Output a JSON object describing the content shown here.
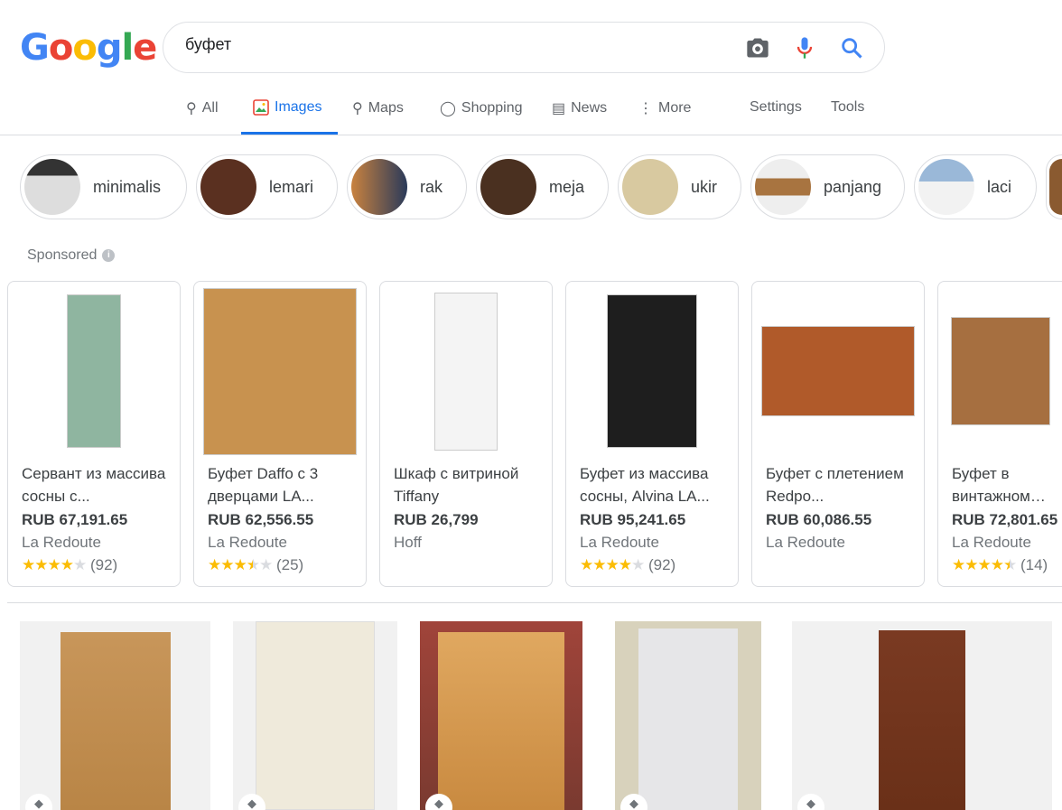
{
  "logo": "Google",
  "search": {
    "query": "буфет"
  },
  "tabs": [
    {
      "label": "All",
      "icon": "search-icon"
    },
    {
      "label": "Images",
      "icon": "image-icon"
    },
    {
      "label": "Maps",
      "icon": "map-pin-icon"
    },
    {
      "label": "Shopping",
      "icon": "tag-icon"
    },
    {
      "label": "News",
      "icon": "news-icon"
    },
    {
      "label": "More",
      "icon": "more-vert-icon"
    }
  ],
  "tools": {
    "settings": "Settings",
    "tools": "Tools"
  },
  "active_tab": "Images",
  "colors": {
    "accent": "#1a73e8",
    "star": "#fbbc04"
  },
  "chips": [
    {
      "label": "minimalis"
    },
    {
      "label": "lemari"
    },
    {
      "label": "rak"
    },
    {
      "label": "meja"
    },
    {
      "label": "ukir"
    },
    {
      "label": "panjang"
    },
    {
      "label": "laci"
    }
  ],
  "sponsored": {
    "label": "Sponsored"
  },
  "products": [
    {
      "title": "Сервант из массива сосны с...",
      "price": "RUB 67,191.65",
      "merchant": "La Redoute",
      "rating": 4,
      "reviews": "(92)"
    },
    {
      "title": "Буфет Daffo с 3 дверцами LA...",
      "price": "RUB 62,556.55",
      "merchant": "La Redoute",
      "rating": 3.5,
      "reviews": "(25)"
    },
    {
      "title": "Шкаф с витриной Tiffany",
      "price": "RUB 26,799",
      "merchant": "Hoff",
      "rating": null,
      "reviews": ""
    },
    {
      "title": "Буфет из массива сосны, Alvina LA...",
      "price": "RUB 95,241.65",
      "merchant": "La Redoute",
      "rating": 4,
      "reviews": "(92)"
    },
    {
      "title": "Буфет с плетением Redpo...",
      "price": "RUB 60,086.55",
      "merchant": "La Redoute",
      "rating": null,
      "reviews": ""
    },
    {
      "title": "Буфет в винтажном сти...",
      "price": "RUB 72,801.65",
      "merchant": "La Redoute",
      "rating": 4.5,
      "reviews": "(14)"
    }
  ]
}
